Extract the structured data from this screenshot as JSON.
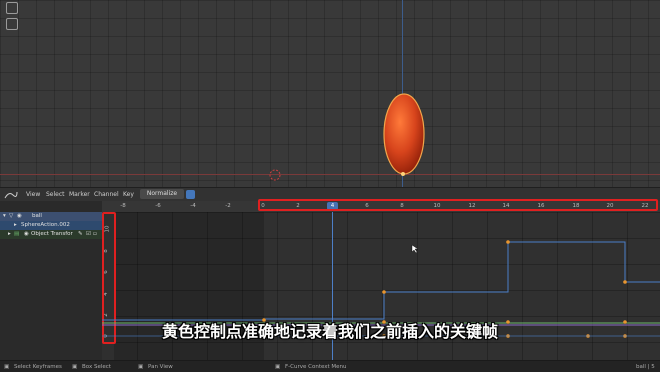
{
  "header": {
    "view": "View",
    "select": "Select",
    "marker": "Marker",
    "channel": "Channel",
    "key": "Key",
    "normalize": "Normalize"
  },
  "channels": {
    "ball": "ball",
    "action": "SphereAction.002",
    "transforms": "Object Transfor"
  },
  "ruler_ticks_left": [
    "-8",
    "-6",
    "-4",
    "-2"
  ],
  "ruler_ticks_right": [
    "0",
    "2",
    "4",
    "6",
    "8",
    "10",
    "12",
    "14",
    "16",
    "18",
    "20",
    "22"
  ],
  "current_frame": "4",
  "y_ticks": [
    "10",
    "8",
    "6",
    "4",
    "2",
    "0"
  ],
  "status": {
    "select_keyframes": "Select Keyframes",
    "box_select": "Box Select",
    "pan_view": "Pan View",
    "context_menu": "F-Curve Context Menu",
    "right": "ball | 5"
  },
  "subtitle": "黄色控制点准确地记录着我们之前插入的关键帧",
  "colors": {
    "highlight_box": "#e02020",
    "keyframe": "#e8952e",
    "curve_blue": "#4a7ec8",
    "curve_green": "#6db86d",
    "ball": "#d7441c"
  }
}
